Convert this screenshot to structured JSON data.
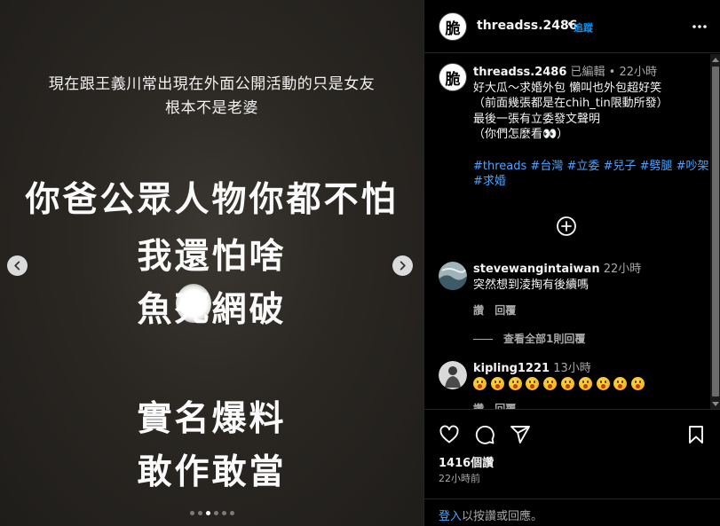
{
  "media": {
    "caption_lines": [
      "現在跟王義川常出現在外面公開活動的只是女友",
      "根本不是老婆"
    ],
    "big_lines": [
      "你爸公眾人物你都不怕",
      "我還怕啥",
      "魚死網破",
      "",
      "實名爆料",
      "敢作敢當"
    ],
    "dots_count": 6,
    "active_dot": 3
  },
  "header": {
    "avatar_char": "脆",
    "username": "threadss.2486",
    "separator": "•",
    "follow_label": "追蹤"
  },
  "caption": {
    "avatar_char": "脆",
    "username": "threadss.2486",
    "edited": "已編輯",
    "separator": "•",
    "time": "22小時",
    "lines": [
      "好大瓜～求婚外包 懶叫也外包超好笑",
      "（前面幾張都是在chih_tin限動所發）",
      "最後一張有立委發文聲明",
      "（你們怎麼看👀）"
    ],
    "tags": [
      "#threads",
      "#台灣",
      "#立委",
      "#兒子",
      "#劈腿",
      "#吵架",
      "#求婚"
    ]
  },
  "comments": [
    {
      "username": "stevewangintaiwan",
      "time": "22小時",
      "text": "突然想到淩掏有後續嗎",
      "actions": [
        "讚",
        "回覆"
      ],
      "view_replies": "查看全部1則回覆"
    },
    {
      "username": "kipling1221",
      "time": "13小時",
      "emoji_count": 10,
      "emoji": "😮",
      "actions": [
        "讚",
        "回覆"
      ]
    }
  ],
  "footer": {
    "likes": "1416個讚",
    "posted": "22小時前",
    "login_link": "登入",
    "login_text": "以按讚或回應。"
  }
}
